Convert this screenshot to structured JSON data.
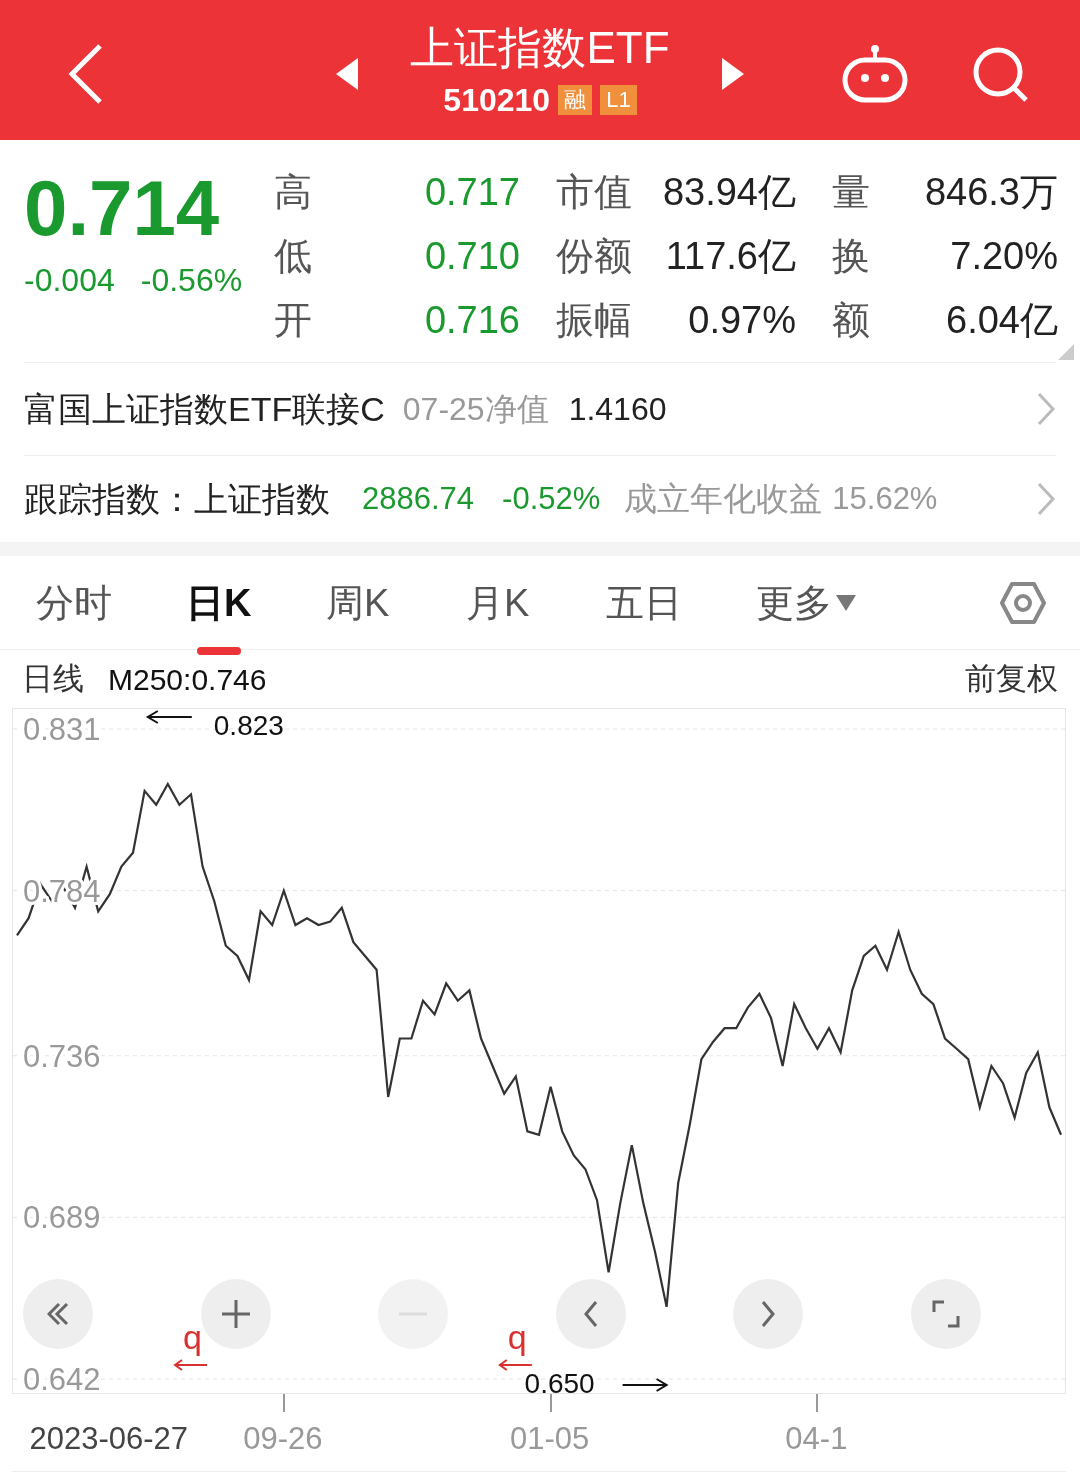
{
  "header": {
    "title": "上证指数ETF",
    "code": "510210",
    "badges": [
      "融",
      "L1"
    ]
  },
  "quote": {
    "price": "0.714",
    "change": "-0.004",
    "change_pct": "-0.56%",
    "color": "#1a9a2e",
    "rows": [
      {
        "cells": [
          {
            "label": "高",
            "value": "0.717",
            "color": "#1a9a2e"
          },
          {
            "label": "市值",
            "value": "83.94亿",
            "color": "#222222"
          },
          {
            "label": "量",
            "value": "846.3万",
            "color": "#222222"
          }
        ]
      },
      {
        "cells": [
          {
            "label": "低",
            "value": "0.710",
            "color": "#1a9a2e"
          },
          {
            "label": "份额",
            "value": "117.6亿",
            "color": "#222222"
          },
          {
            "label": "换",
            "value": "7.20%",
            "color": "#222222"
          }
        ]
      },
      {
        "cells": [
          {
            "label": "开",
            "value": "0.716",
            "color": "#1a9a2e"
          },
          {
            "label": "振幅",
            "value": "0.97%",
            "color": "#222222"
          },
          {
            "label": "额",
            "value": "6.04亿",
            "color": "#222222"
          }
        ]
      }
    ]
  },
  "fund_row": {
    "name": "富国上证指数ETF联接C",
    "date_label": "07-25净值",
    "nav": "1.4160"
  },
  "index_row": {
    "label": "跟踪指数：上证指数",
    "value": "2886.74",
    "change": "-0.52%",
    "color": "#1a9a2e",
    "annual_label": "成立年化收益",
    "annual": "15.62%"
  },
  "tabs": [
    {
      "label": "分时",
      "selected": false,
      "kind": "plain"
    },
    {
      "label": "日K",
      "selected": true,
      "kind": "plain"
    },
    {
      "label": "周K",
      "selected": false,
      "kind": "plain"
    },
    {
      "label": "月K",
      "selected": false,
      "kind": "plain"
    },
    {
      "label": "五日",
      "selected": false,
      "kind": "plain"
    },
    {
      "label": "更多",
      "selected": false,
      "kind": "dropdown"
    }
  ],
  "chart_header": {
    "period": "日线",
    "ma": "M250:0.746",
    "adjust": "前复权"
  },
  "chart": {
    "chart_data": {
      "type": "line",
      "ylim": [
        0.642,
        0.831
      ],
      "grid": true,
      "categories": [
        null,
        null,
        null,
        null,
        null,
        null,
        null,
        null,
        "2023-06-27",
        null,
        null,
        null,
        null,
        null,
        null,
        null,
        null,
        null,
        null,
        null,
        null,
        null,
        null,
        "09-26",
        null,
        null,
        null,
        null,
        null,
        null,
        null,
        null,
        null,
        null,
        null,
        null,
        null,
        null,
        null,
        null,
        null,
        null,
        null,
        null,
        null,
        null,
        "01-05",
        null,
        null,
        null,
        null,
        null,
        null,
        null,
        null,
        null,
        null,
        null,
        null,
        null,
        null,
        null,
        null,
        null,
        null,
        null,
        null,
        null,
        null,
        "04-1",
        null,
        null,
        null,
        null,
        null,
        null,
        null,
        null,
        null,
        null,
        null,
        null,
        null,
        null,
        null,
        null,
        null,
        null,
        null,
        null,
        null
      ],
      "yticks": [
        {
          "value": 0.831,
          "label": "0.831"
        },
        {
          "value": 0.784,
          "label": "0.784"
        },
        {
          "value": 0.736,
          "label": "0.736"
        },
        {
          "value": 0.689,
          "label": "0.689"
        },
        {
          "value": 0.642,
          "label": "0.642"
        }
      ],
      "series": [
        {
          "color": "#333333",
          "values": [
            0.771,
            0.776,
            0.786,
            0.781,
            0.785,
            0.779,
            0.791,
            0.778,
            0.783,
            0.791,
            0.795,
            0.813,
            0.809,
            0.815,
            0.809,
            0.812,
            0.791,
            0.781,
            0.768,
            0.765,
            0.758,
            0.778,
            0.774,
            0.784,
            0.774,
            0.776,
            0.774,
            0.775,
            0.779,
            0.769,
            0.765,
            0.761,
            0.724,
            0.741,
            0.741,
            0.752,
            0.748,
            0.757,
            0.752,
            0.755,
            0.741,
            0.733,
            0.725,
            0.73,
            0.714,
            0.713,
            0.727,
            0.714,
            0.707,
            0.703,
            0.694,
            0.673,
            0.693,
            0.71,
            0.693,
            0.679,
            0.663,
            0.699,
            0.716,
            0.735,
            0.74,
            0.744,
            0.744,
            0.75,
            0.754,
            0.747,
            0.733,
            0.751,
            0.744,
            0.738,
            0.744,
            0.737,
            0.755,
            0.765,
            0.768,
            0.761,
            0.772,
            0.761,
            0.754,
            0.751,
            0.741,
            0.738,
            0.735,
            0.721,
            0.733,
            0.728,
            0.718,
            0.731,
            0.737,
            0.721,
            0.713
          ]
        }
      ],
      "annotations": [
        {
          "text": "0.823"
        },
        {
          "text": "0.650"
        }
      ]
    },
    "trade_markers": [
      {
        "text": "q"
      },
      {
        "text": "q"
      }
    ]
  },
  "controls": [
    {
      "kind": "first",
      "disabled": false
    },
    {
      "kind": "zoom_in",
      "disabled": false
    },
    {
      "kind": "zoom_out",
      "disabled": true
    },
    {
      "kind": "prev",
      "disabled": false
    },
    {
      "kind": "next",
      "disabled": false
    },
    {
      "kind": "fullscreen",
      "disabled": false
    }
  ]
}
